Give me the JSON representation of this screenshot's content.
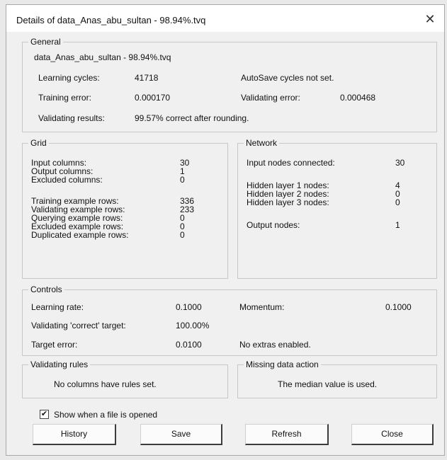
{
  "window": {
    "title": "Details of data_Anas_abu_sultan - 98.94%.tvq",
    "close_glyph": "✕"
  },
  "general": {
    "label": "General",
    "filename": "data_Anas_abu_sultan - 98.94%.tvq",
    "learning_cycles_label": "Learning cycles:",
    "learning_cycles_value": "41718",
    "autosave_text": "AutoSave cycles not set.",
    "training_error_label": "Training error:",
    "training_error_value": "0.000170",
    "validating_error_label": "Validating error:",
    "validating_error_value": "0.000468",
    "validating_results_label": "Validating results:",
    "validating_results_value": "99.57% correct after rounding."
  },
  "grid": {
    "label": "Grid",
    "rows": [
      {
        "label": "Input columns:",
        "value": "30"
      },
      {
        "label": "Output columns:",
        "value": "1"
      },
      {
        "label": "Excluded columns:",
        "value": "0"
      },
      {
        "label": "Training example rows:",
        "value": "336"
      },
      {
        "label": "Validating example rows:",
        "value": "233"
      },
      {
        "label": "Querying example rows:",
        "value": "0"
      },
      {
        "label": "Excluded example rows:",
        "value": "0"
      },
      {
        "label": "Duplicated example rows:",
        "value": "0"
      }
    ]
  },
  "network": {
    "label": "Network",
    "rows": [
      {
        "label": "Input nodes connected:",
        "value": "30"
      },
      {
        "label": "Hidden layer 1 nodes:",
        "value": "4"
      },
      {
        "label": "Hidden layer 2 nodes:",
        "value": "0"
      },
      {
        "label": "Hidden layer 3 nodes:",
        "value": "0"
      },
      {
        "label": "Output nodes:",
        "value": "1"
      }
    ]
  },
  "controls": {
    "label": "Controls",
    "learning_rate_label": "Learning rate:",
    "learning_rate_value": "0.1000",
    "momentum_label": "Momentum:",
    "momentum_value": "0.1000",
    "target_label": "Validating 'correct' target:",
    "target_value": "100.00%",
    "target_error_label": "Target error:",
    "target_error_value": "0.0100",
    "extras_text": "No extras enabled."
  },
  "validating_rules": {
    "label": "Validating rules",
    "text": "No columns have rules set."
  },
  "missing_data": {
    "label": "Missing data action",
    "text": "The median value is used."
  },
  "show_when_opened": {
    "label": "Show when a file is opened",
    "checked": true,
    "check_glyph": "✔"
  },
  "buttons": {
    "history": "History",
    "save": "Save",
    "refresh": "Refresh",
    "close": "Close"
  }
}
